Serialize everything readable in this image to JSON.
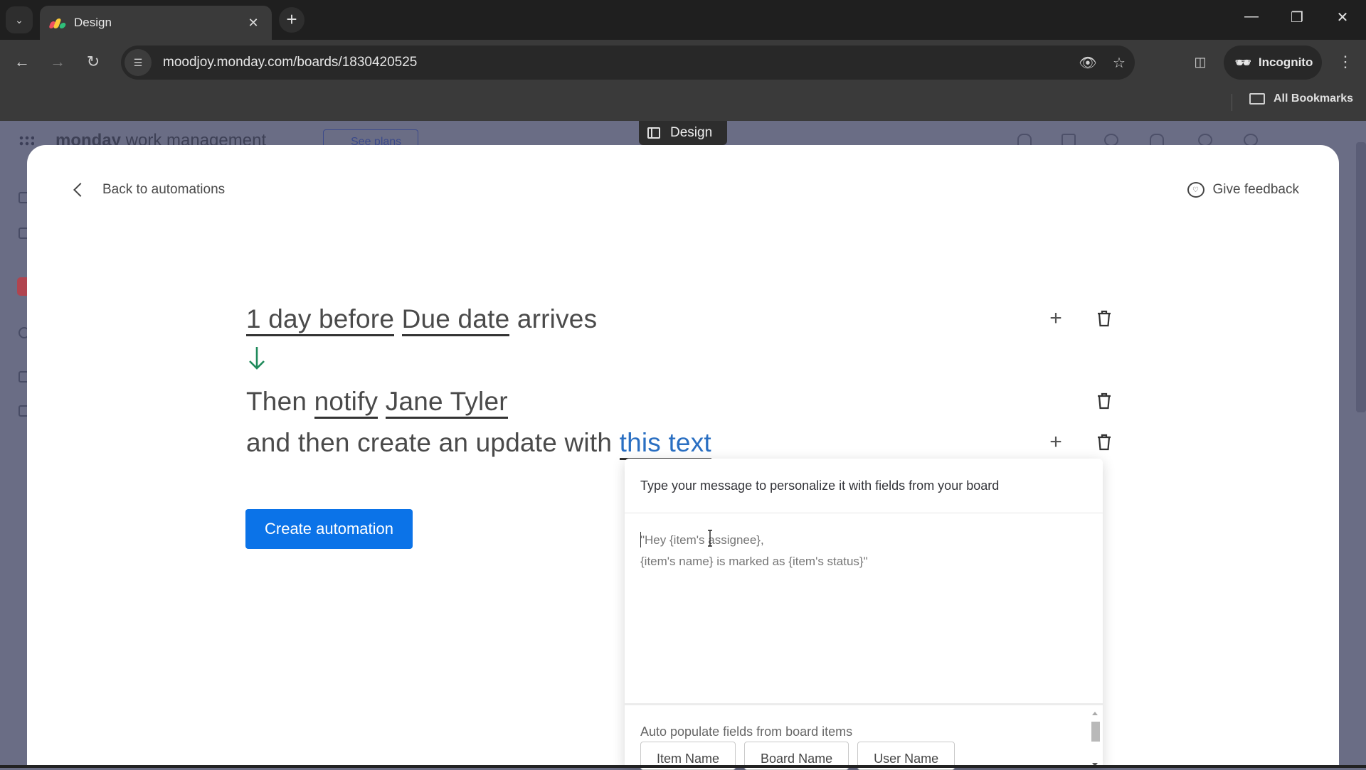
{
  "browser": {
    "tab_title": "Design",
    "url": "moodjoy.monday.com/boards/1830420525",
    "profile_label": "Incognito",
    "bookmarks_label": "All Bookmarks",
    "icons": {
      "tab_search": "chevron-down-icon",
      "new_tab": "plus-icon",
      "back": "arrow-left-icon",
      "forward": "arrow-right-icon",
      "reload": "reload-icon",
      "site_info": "tune-icon",
      "eye_off": "eye-off-icon",
      "star": "star-icon",
      "side_panel": "side-panel-icon",
      "menu": "kebab-icon"
    }
  },
  "app_background": {
    "logo_text_bold": "monday",
    "logo_text_light": " work management",
    "see_plans_label": "See plans",
    "view_chip_label": "Design"
  },
  "modal": {
    "back_label": "Back to automations",
    "feedback_label": "Give feedback",
    "trigger": {
      "amount": "1 day before",
      "column": "Due date",
      "suffix": "arrives"
    },
    "action1": {
      "prefix": "Then",
      "verb": "notify",
      "person": "Jane Tyler"
    },
    "action2": {
      "prefix": "and then create an update with",
      "value": "this text"
    },
    "create_button": "Create automation",
    "colors": {
      "primary": "#0b73e8",
      "arrow": "#1f8a5b",
      "link": "#2a6fc2"
    }
  },
  "popover": {
    "title": "Type your message to personalize it with fields from your board",
    "placeholder": "\"Hey {item's assignee},\n{item's name} is marked as {item's status}\"",
    "auto_label": "Auto populate fields from board items",
    "chips": [
      "Item Name",
      "Board Name",
      "User Name"
    ]
  }
}
